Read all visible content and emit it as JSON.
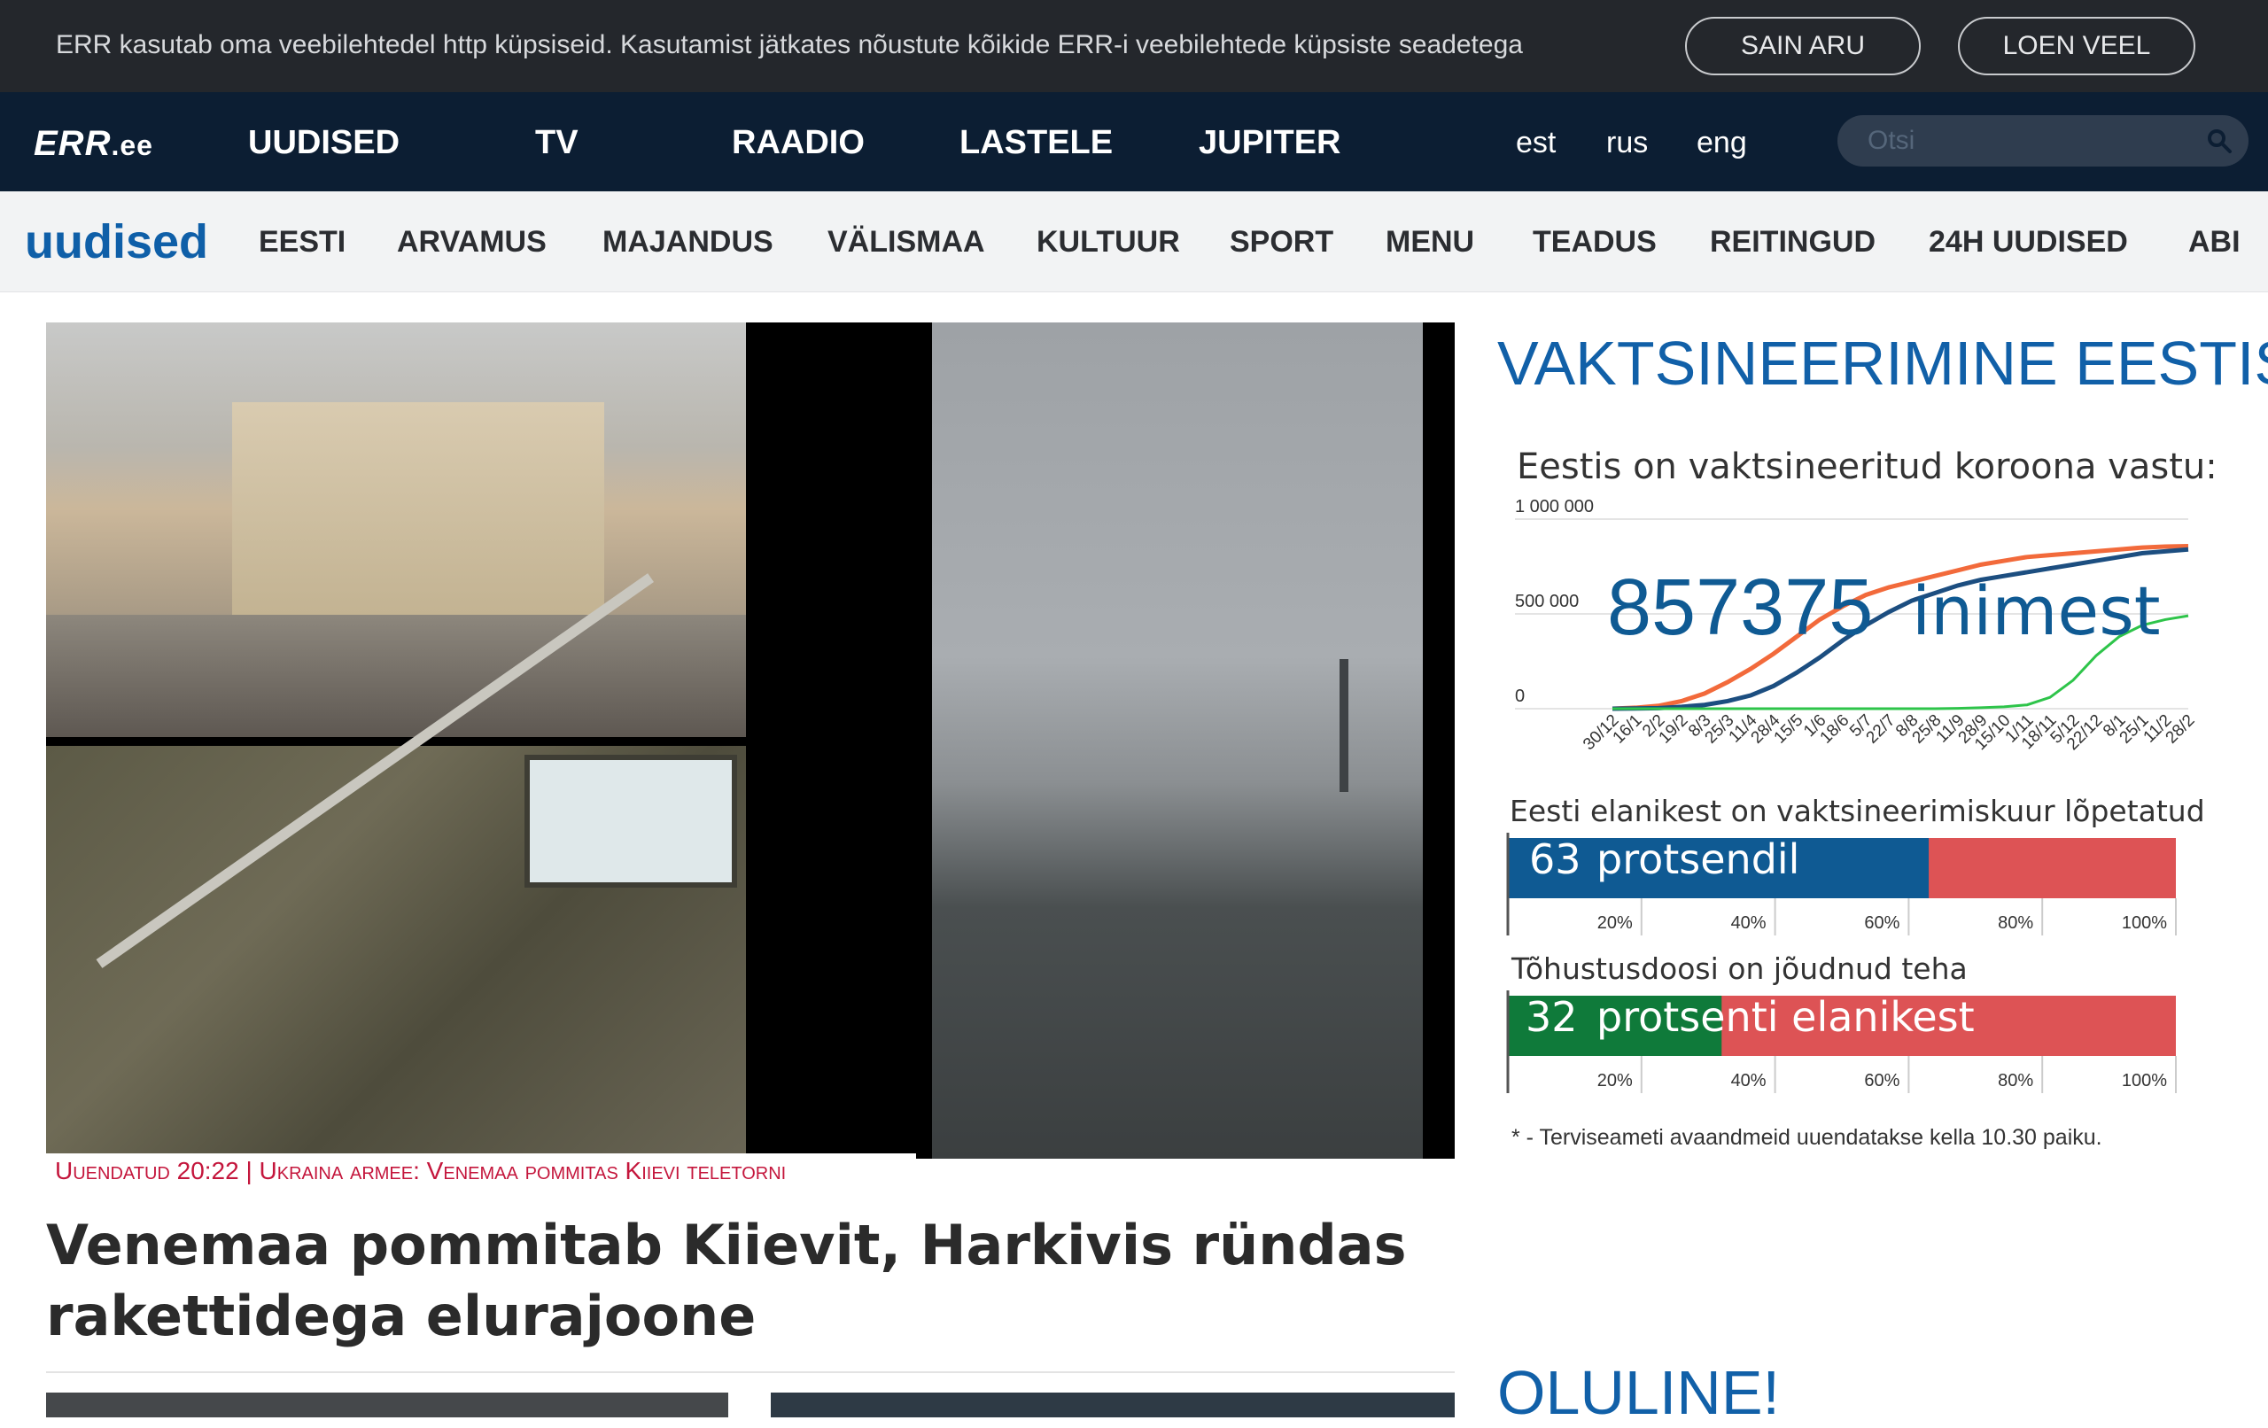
{
  "cookie": {
    "text": "ERR kasutab oma veebilehtedel http küpsiseid. Kasutamist jätkates nõustute kõikide ERR-i veebilehtede küpsiste seadetega",
    "accept_label": "SAIN ARU",
    "more_label": "LOEN VEEL"
  },
  "top_nav": {
    "logo": "ERR",
    "logo_suffix": ".ee",
    "links": [
      "UUDISED",
      "TV",
      "RAADIO",
      "LASTELE",
      "JUPITER"
    ],
    "languages": [
      "est",
      "rus",
      "eng"
    ],
    "search_placeholder": "Otsi"
  },
  "section_nav": {
    "logo": "uudised",
    "links": [
      "EESTI",
      "ARVAMUS",
      "MAJANDUS",
      "VÄLISMAA",
      "KULTUUR",
      "SPORT",
      "MENU",
      "TEADUS",
      "REITINGUD",
      "24H UUDISED",
      "ABI"
    ]
  },
  "hero": {
    "kicker": "Uuendatud 20:22 | Ukraina armee: Venemaa pommitas Kiievi teletorni",
    "title": "Venemaa pommitab Kiievit, Harkivis ründas rakettidega elurajoone"
  },
  "vaccination": {
    "heading": "VAKTSINEERIMINE EESTIS",
    "subheading": "Eestis on vaktsineeritud koroona vastu:",
    "total_count": "857375",
    "total_unit": "inimest",
    "completed_label": "Eesti elanikest on vaktsineerimiskuur lõpetatud",
    "completed_value": "63",
    "completed_unit": "protsendil",
    "booster_label": "Tõhustusdoosi on jõudnud teha",
    "booster_value": "32",
    "booster_unit": "protsenti elanikest",
    "note": "* - Terviseameti avaandmeid uuendatakse kella 10.30 paiku.",
    "colors": {
      "blue": "#0f5a93",
      "red": "#dd5355",
      "green": "#0f7a3a",
      "orange": "#f26a3b",
      "dark_blue": "#1c4e80",
      "light_green": "#2ec44a",
      "heading": "#1160a8"
    }
  },
  "oluline": "OLULINE!",
  "chart_data": [
    {
      "type": "line",
      "title": "Eestis on vaktsineeritud koroona vastu:",
      "x": [
        "30/12",
        "16/1",
        "2/2",
        "19/2",
        "8/3",
        "25/3",
        "11/4",
        "28/4",
        "15/5",
        "1/6",
        "18/6",
        "5/7",
        "22/7",
        "8/8",
        "25/8",
        "11/9",
        "28/9",
        "15/10",
        "1/11",
        "18/11",
        "5/12",
        "22/12",
        "8/1",
        "25/1",
        "11/2",
        "28/2"
      ],
      "y_ticks": [
        "0",
        "500 000",
        "1 000 000"
      ],
      "ylim": [
        0,
        1000000
      ],
      "series": [
        {
          "values": [
            0,
            5000,
            15000,
            40000,
            80000,
            140000,
            210000,
            290000,
            380000,
            470000,
            540000,
            600000,
            640000,
            670000,
            700000,
            730000,
            760000,
            780000,
            800000,
            810000,
            820000,
            830000,
            840000,
            850000,
            855000,
            857375
          ]
        },
        {
          "values": [
            0,
            1000,
            3000,
            10000,
            20000,
            40000,
            70000,
            120000,
            190000,
            270000,
            360000,
            440000,
            510000,
            570000,
            610000,
            650000,
            680000,
            700000,
            720000,
            740000,
            760000,
            780000,
            800000,
            820000,
            830000,
            840000
          ]
        },
        {
          "values": [
            0,
            0,
            0,
            0,
            0,
            0,
            0,
            0,
            0,
            0,
            0,
            0,
            0,
            0,
            0,
            2000,
            5000,
            10000,
            20000,
            60000,
            150000,
            280000,
            380000,
            440000,
            470000,
            490000
          ]
        }
      ]
    },
    {
      "type": "bar",
      "title": "Eesti elanikest on vaktsineerimiskuur lõpetatud",
      "categories": [
        ""
      ],
      "values": [
        63
      ],
      "x_ticks": [
        "20%",
        "40%",
        "60%",
        "80%",
        "100%"
      ],
      "xlim": [
        0,
        100
      ]
    },
    {
      "type": "bar",
      "title": "Tõhustusdoosi on jõudnud teha",
      "categories": [
        ""
      ],
      "values": [
        32
      ],
      "x_ticks": [
        "20%",
        "40%",
        "60%",
        "80%",
        "100%"
      ],
      "xlim": [
        0,
        100
      ]
    }
  ]
}
